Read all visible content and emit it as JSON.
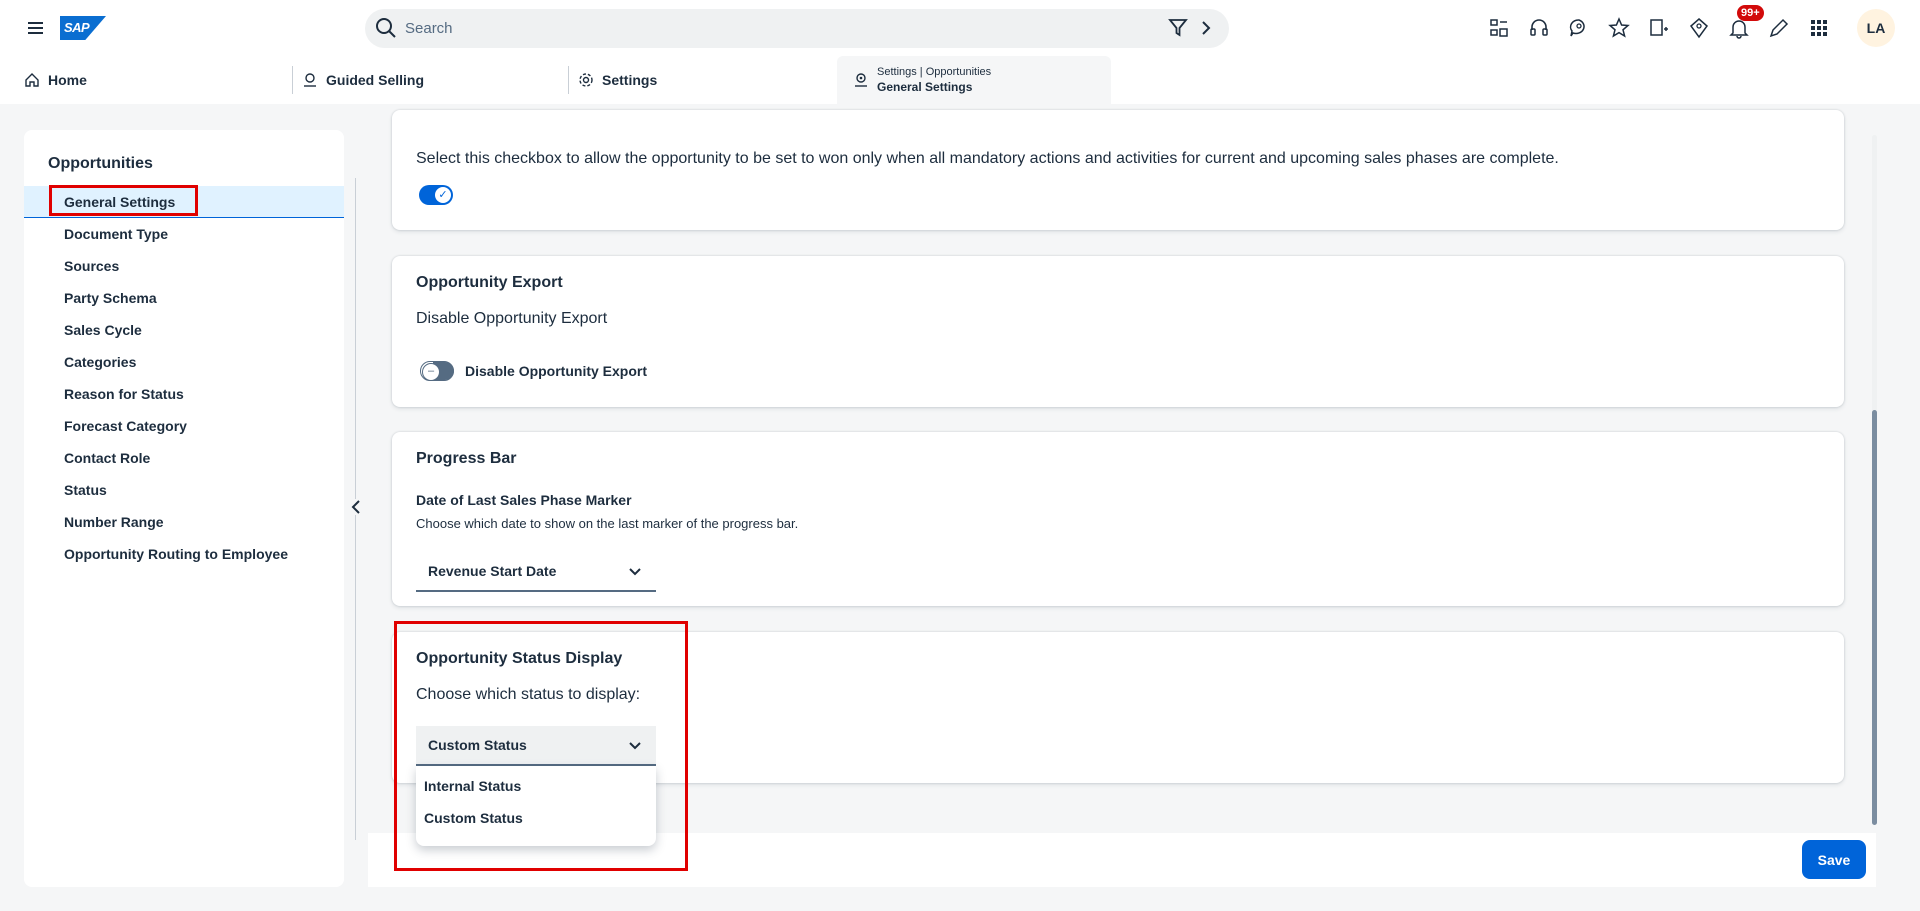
{
  "shell": {
    "search_placeholder": "Search",
    "notification_count": "99+",
    "avatar_initials": "LA"
  },
  "tabs": {
    "home": "Home",
    "guided_selling": "Guided Selling",
    "settings": "Settings",
    "active_sub": "Settings | Opportunities",
    "active_main": "General Settings"
  },
  "sidebar": {
    "title": "Opportunities",
    "items": [
      "General Settings",
      "Document Type",
      "Sources",
      "Party Schema",
      "Sales Cycle",
      "Categories",
      "Reason for Status",
      "Forecast Category",
      "Contact Role",
      "Status",
      "Number Range",
      "Opportunity Routing to Employee"
    ],
    "selected_index": 0
  },
  "card_mandatory": {
    "description": "Select this checkbox to allow the opportunity to be set to won only when all mandatory actions and activities for current and upcoming sales phases are complete.",
    "toggle_on": true
  },
  "card_export": {
    "title": "Opportunity Export",
    "description": "Disable Opportunity Export",
    "toggle_label": "Disable Opportunity Export",
    "toggle_on": false
  },
  "card_progress": {
    "title": "Progress Bar",
    "field_label": "Date of Last Sales Phase Marker",
    "field_hint": "Choose which date to show on the last marker of the progress bar.",
    "selected": "Revenue Start Date"
  },
  "card_status": {
    "title": "Opportunity Status Display",
    "description": "Choose which status to display:",
    "selected": "Custom Status",
    "options": [
      "Internal Status",
      "Custom Status"
    ]
  },
  "footer": {
    "save_label": "Save"
  },
  "colors": {
    "accent": "#0064d9",
    "highlight_box": "#e00000",
    "badge": "#d20a0a"
  }
}
